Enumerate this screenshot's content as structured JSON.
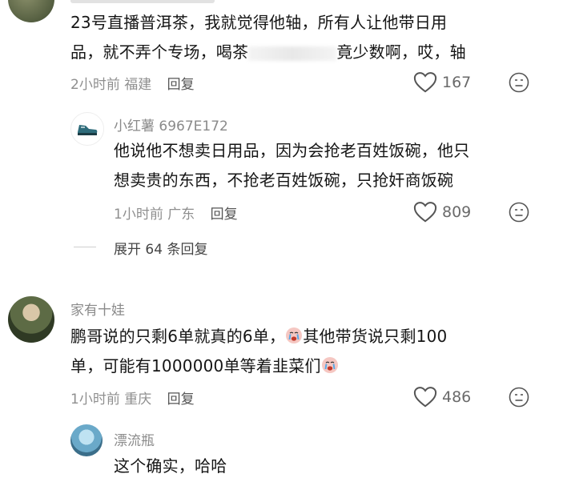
{
  "comments": [
    {
      "text_line1": "23号直播普洱茶，我就觉得他轴，所有人让他带日用",
      "text_line2_a": "品，就不弄个专场，喝茶",
      "text_line2_b": "竟少数啊，哎，轴",
      "time": "2小时前",
      "location": "福建",
      "reply_label": "回复",
      "likes": "167",
      "replies": [
        {
          "username": "小红薯 6967E172",
          "text_line1": "他说他不想卖日用品，因为会抢老百姓饭碗，他只",
          "text_line2": "想卖贵的东西，不抢老百姓饭碗，只抢奸商饭碗",
          "time": "1小时前",
          "location": "广东",
          "reply_label": "回复",
          "likes": "809"
        }
      ],
      "expand_label": "展开 64 条回复"
    },
    {
      "username": "家有十娃",
      "text_line1_a": "鹏哥说的只剩6单就真的6单，",
      "text_line1_b": "其他带货说只剩100",
      "text_line2": "单，可能有1000000单等着韭菜们",
      "time": "1小时前",
      "location": "重庆",
      "reply_label": "回复",
      "likes": "486",
      "replies": [
        {
          "username": "漂流瓶",
          "text": "这个确实，哈哈"
        }
      ]
    }
  ],
  "icons": [
    "heart-icon",
    "dislike-face-icon",
    "crying-emoji-icon"
  ],
  "colors": {
    "meta": "#8f8f8f",
    "text": "#151515",
    "username": "#8a8a8a"
  }
}
